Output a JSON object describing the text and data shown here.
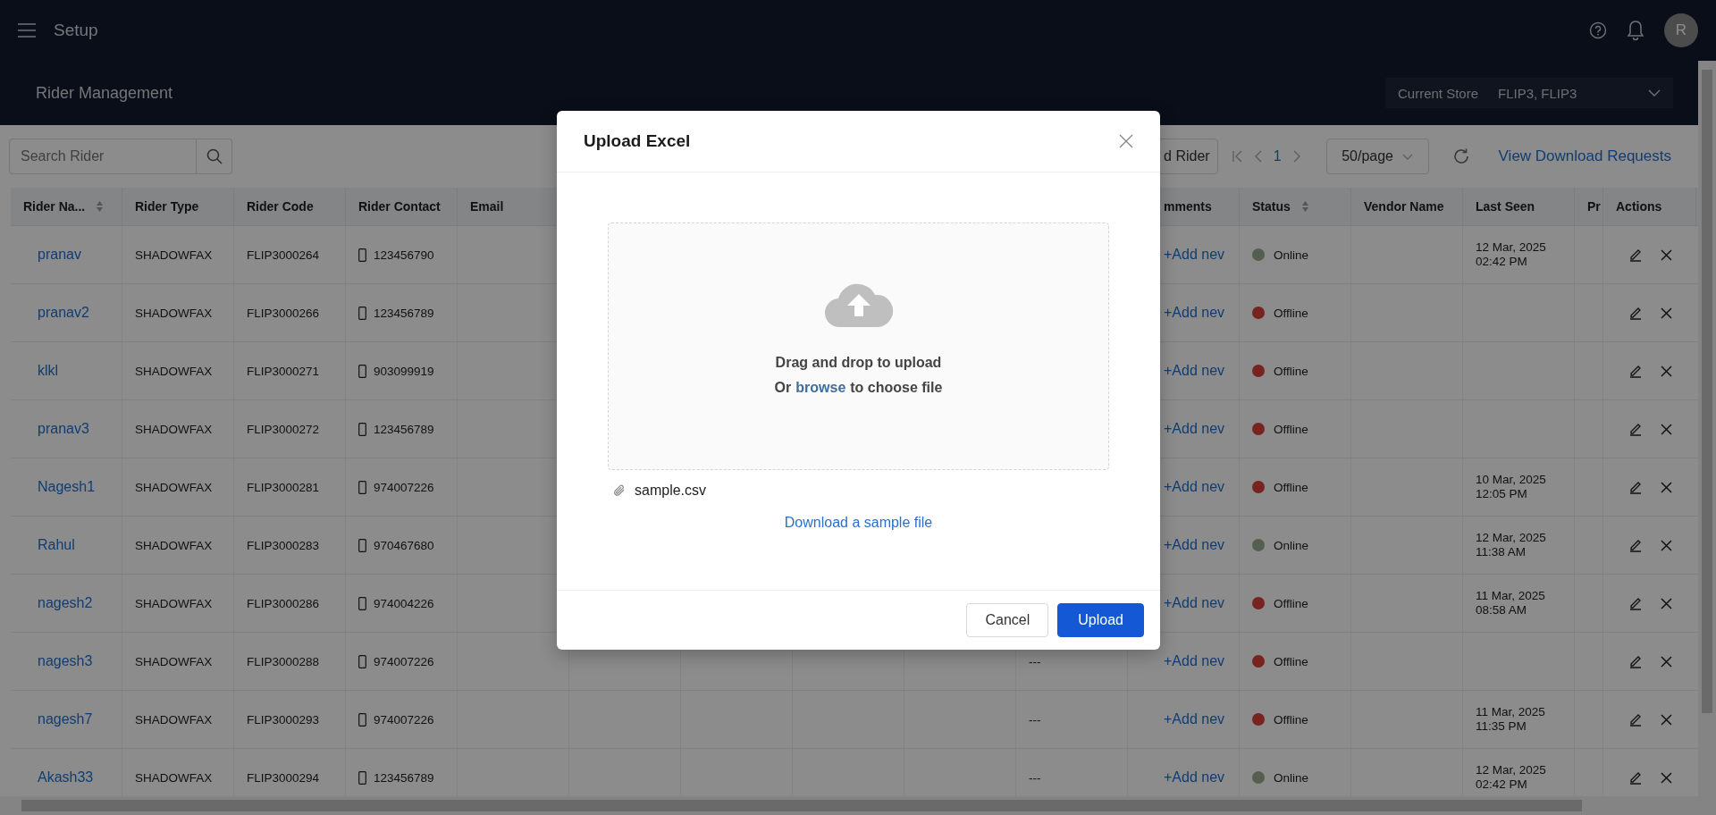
{
  "topbar": {
    "title": "Setup",
    "avatar": "R"
  },
  "page_header": {
    "title": "Rider Management",
    "store": {
      "label": "Current Store",
      "value": "FLIP3, FLIP3"
    }
  },
  "toolbar": {
    "search": {
      "placeholder": "Search Rider"
    },
    "add_button": "d Rider",
    "pagination": {
      "page": "1"
    },
    "page_size": "50/page",
    "download_link": "View Download Requests"
  },
  "table": {
    "columns": [
      {
        "label": "Rider Na...",
        "sortable": true
      },
      {
        "label": "Rider Type",
        "sortable": false
      },
      {
        "label": "Rider Code",
        "sortable": false
      },
      {
        "label": "Rider Contact",
        "sortable": false
      },
      {
        "label": "Email",
        "sortable": false
      },
      {},
      {},
      {},
      {},
      {},
      {
        "label": "mments",
        "sortable": false
      },
      {
        "label": "Status",
        "sortable": true
      },
      {
        "label": "Vendor Name",
        "sortable": false
      },
      {
        "label": "Last Seen",
        "sortable": false
      },
      {
        "label": "Pr"
      },
      {
        "label": "Actions",
        "sortable": false
      }
    ],
    "rows": [
      {
        "name": "pranav",
        "type": "SHADOWFAX",
        "code": "FLIP3000264",
        "contact": "123456790",
        "comment": "+Add nev",
        "status": {
          "label": "Online",
          "color": "#555f4f"
        },
        "last_seen": {
          "date": "12 Mar, 2025",
          "time": "02:42 PM"
        }
      },
      {
        "name": "pranav2",
        "type": "SHADOWFAX",
        "code": "FLIP3000266",
        "contact": "123456789",
        "comment": "+Add nev",
        "status": {
          "label": "Offline",
          "color": "#772320"
        }
      },
      {
        "name": "klkl",
        "type": "SHADOWFAX",
        "code": "FLIP3000271",
        "contact": "903099919",
        "comment": "+Add nev",
        "status": {
          "label": "Offline",
          "color": "#772320"
        }
      },
      {
        "name": "pranav3",
        "type": "SHADOWFAX",
        "code": "FLIP3000272",
        "contact": "123456789",
        "comment": "+Add nev",
        "status": {
          "label": "Offline",
          "color": "#772320"
        }
      },
      {
        "name": "Nagesh1",
        "type": "SHADOWFAX",
        "code": "FLIP3000281",
        "contact": "974007226",
        "comment": "+Add nev",
        "status": {
          "label": "Offline",
          "color": "#772320"
        },
        "last_seen": {
          "date": "10 Mar, 2025",
          "time": "12:05 PM"
        }
      },
      {
        "name": "Rahul",
        "type": "SHADOWFAX",
        "code": "FLIP3000283",
        "contact": "970467680",
        "comment": "+Add nev",
        "status": {
          "label": "Online",
          "color": "#555f4f"
        },
        "last_seen": {
          "date": "12 Mar, 2025",
          "time": "11:38 AM"
        }
      },
      {
        "name": "nagesh2",
        "type": "SHADOWFAX",
        "code": "FLIP3000286",
        "contact": "974004226",
        "comment": "+Add nev",
        "status": {
          "label": "Offline",
          "color": "#772320"
        },
        "last_seen": {
          "date": "11 Mar, 2025",
          "time": "08:58 AM"
        }
      },
      {
        "name": "nagesh3",
        "type": "SHADOWFAX",
        "code": "FLIP3000288",
        "contact": "974007226",
        "column_10": "---",
        "comment": "+Add nev",
        "status": {
          "label": "Offline",
          "color": "#772320"
        }
      },
      {
        "name": "nagesh7",
        "type": "SHADOWFAX",
        "code": "FLIP3000293",
        "contact": "974007226",
        "column_10": "---",
        "comment": "+Add nev",
        "status": {
          "label": "Offline",
          "color": "#772320"
        },
        "last_seen": {
          "date": "11 Mar, 2025",
          "time": "11:35 PM"
        }
      },
      {
        "name": "Akash33",
        "type": "SHADOWFAX",
        "code": "FLIP3000294",
        "contact": "123456789",
        "column_10": "---",
        "comment": "+Add nev",
        "status": {
          "label": "Online",
          "color": "#555f4f"
        },
        "last_seen": {
          "date": "12 Mar, 2025",
          "time": "02:42 PM"
        }
      }
    ]
  },
  "modal": {
    "title": "Upload Excel",
    "drop_text": "Drag and drop to upload",
    "browse_prefix": "Or",
    "browse_link": "browse",
    "browse_suffix": "to choose file",
    "file": "sample.csv",
    "sample_link": "Download a sample file",
    "buttons": [
      {
        "label": "Cancel",
        "kind": "secondary"
      },
      {
        "label": "Upload",
        "kind": "primary"
      }
    ]
  }
}
